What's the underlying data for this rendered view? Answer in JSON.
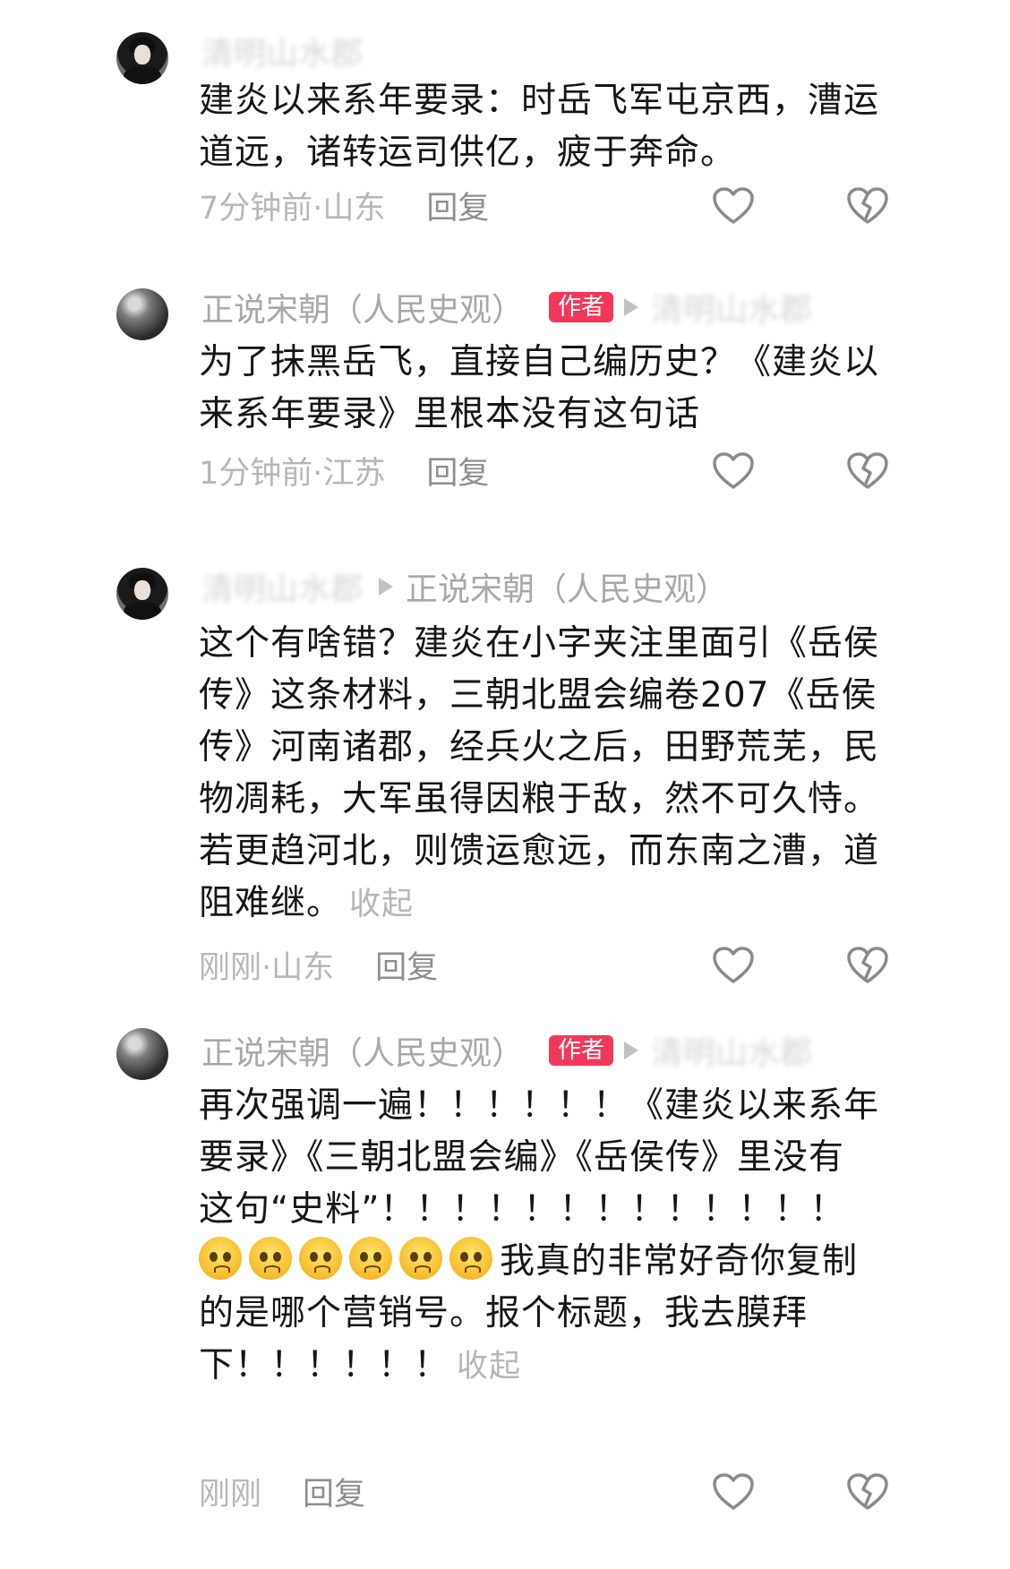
{
  "comments": [
    {
      "username": "清明山水郡",
      "text": "建炎以来系年要录：时岳飞军屯京西，漕运道远，诸转运司供亿，疲于奔命。",
      "time_location": "7分钟前·山东",
      "reply_label": "回复"
    },
    {
      "username": "正说宋朝（人民史观）",
      "badge": "作者",
      "reply_to": "清明山水郡",
      "text": "为了抹黑岳飞，直接自己编历史？《建炎以来系年要录》里根本没有这句话",
      "time_location": "1分钟前·江苏",
      "reply_label": "回复"
    },
    {
      "username": "清明山水郡",
      "reply_to": "正说宋朝（人民史观）",
      "text": "这个有啥错？建炎在小字夹注里面引《岳侯传》这条材料，三朝北盟会编卷207《岳侯传》河南诸郡，经兵火之后，田野荒芜，民物凋耗，大军虽得因粮于敌，然不可久恃。若更趋河北，则馈运愈远，而东南之漕，道阻难继。",
      "collapse_label": "收起",
      "time_location": "刚刚·山东",
      "reply_label": "回复"
    },
    {
      "username": "正说宋朝（人民史观）",
      "badge": "作者",
      "reply_to": "清明山水郡",
      "text_a": "再次强调一遍！！！！！！《建炎以来系年要录》《三朝北盟会编》《岳侯传》里没有这句“史料”！！！！！！！！！！！！！",
      "text_b": "我真的非常好奇你复制的是哪个营销号。报个标题，我去膜拜下！！！！！！",
      "collapse_label": "收起",
      "time_location": "刚刚",
      "reply_label": "回复"
    }
  ],
  "icons": {
    "like": "heart-outline-icon",
    "dislike": "broken-heart-icon"
  },
  "colors": {
    "badge": "#f2385a",
    "meta_text": "#b7b7b7",
    "body_text": "#161616"
  }
}
